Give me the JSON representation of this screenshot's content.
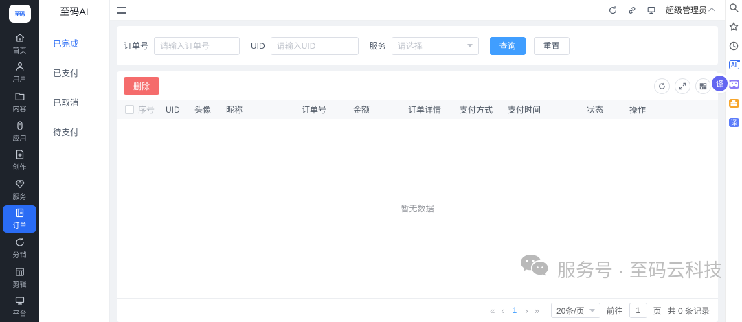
{
  "app": {
    "logo_text": "至码",
    "brand": "至码AI"
  },
  "rail": {
    "items": [
      {
        "label": "首页",
        "icon": "home-icon"
      },
      {
        "label": "用户",
        "icon": "user-icon"
      },
      {
        "label": "内容",
        "icon": "folder-icon"
      },
      {
        "label": "应用",
        "icon": "app-icon"
      },
      {
        "label": "创作",
        "icon": "create-icon"
      },
      {
        "label": "服务",
        "icon": "service-icon"
      },
      {
        "label": "订单",
        "icon": "order-icon",
        "active": true
      },
      {
        "label": "分销",
        "icon": "distribution-icon"
      },
      {
        "label": "剪辑",
        "icon": "clip-icon"
      },
      {
        "label": "平台",
        "icon": "platform-icon"
      }
    ]
  },
  "submenu": {
    "title": "至码AI",
    "items": [
      {
        "label": "已完成",
        "active": true
      },
      {
        "label": "已支付"
      },
      {
        "label": "已取消"
      },
      {
        "label": "待支付"
      }
    ]
  },
  "topbar": {
    "admin_name": "超级管理员"
  },
  "search": {
    "order_no_label": "订单号",
    "order_no_placeholder": "请输入订单号",
    "uid_label": "UID",
    "uid_placeholder": "请输入UID",
    "service_label": "服务",
    "service_placeholder": "请选择",
    "query_label": "查询",
    "reset_label": "重置"
  },
  "table": {
    "delete_label": "删除",
    "columns": [
      "序号",
      "UID",
      "头像",
      "昵称",
      "订单号",
      "金额",
      "订单详情",
      "支付方式",
      "支付时间",
      "状态",
      "操作"
    ],
    "empty_text": "暂无数据"
  },
  "pagination": {
    "first": "«",
    "prev": "‹",
    "current_page": "1",
    "next": "›",
    "last": "»",
    "page_size": "20条/页",
    "goto_label": "前往",
    "goto_value": "1",
    "page_unit": "页",
    "total_text": "共 0 条记录"
  },
  "watermark": {
    "text": "服务号 · 至码云科技"
  },
  "right_strip": {
    "ai_label": "AI",
    "translate_label": "译"
  },
  "float_badge": {
    "translate_label": "译"
  },
  "colors": {
    "accent_blue": "#2a6cf5",
    "button_blue": "#409eff",
    "danger_red": "#f56c6c",
    "rail_bg": "#1e232b"
  }
}
